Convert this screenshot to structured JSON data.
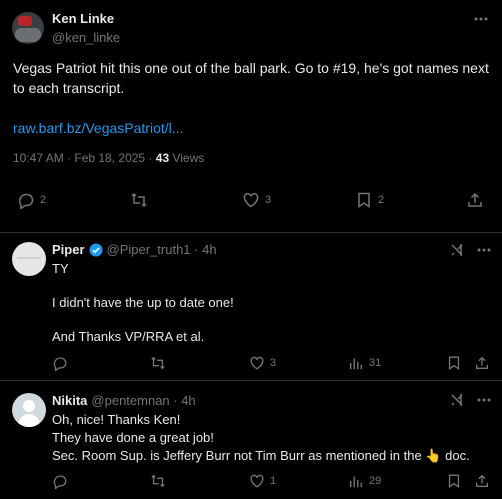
{
  "main_post": {
    "author_name": "Ken Linke",
    "author_handle": "@ken_linke",
    "text": "Vegas Patriot hit this one out of the ball park. Go to #19, he's got names next to each transcript.",
    "link": "raw.barf.bz/VegasPatriot/l...",
    "timestamp": "10:47 AM · Feb 18, 2025 · ",
    "views_count": "43",
    "views_label": " Views",
    "stats": {
      "replies": "2",
      "reposts": "",
      "likes": "3",
      "bookmarks": "2"
    }
  },
  "replies": [
    {
      "author_name": "Piper",
      "author_handle": "@Piper_truth1 · 4h",
      "lines": [
        "TY",
        "I didn't have the up to date one!",
        "And Thanks VP/RRA et al."
      ],
      "stats": {
        "replies": "",
        "reposts": "",
        "likes": "3",
        "views": "31"
      }
    },
    {
      "author_name": "Nikita",
      "author_handle": "@pentemnan · 4h",
      "lines": [
        "Oh, nice! Thanks Ken!",
        "They have done a great job!",
        "Sec. Room Sup. is Jeffery Burr not Tim Burr as mentioned in the ",
        " doc."
      ],
      "emoji": "👆",
      "stats": {
        "replies": "",
        "reposts": "",
        "likes": "1",
        "views": "29"
      }
    }
  ],
  "colors": {
    "background": "#000000",
    "text": "#e7e9ea",
    "muted": "#71767b",
    "link": "#1d9bf0",
    "verified": "#1d9bf0",
    "divider": "#2f3336"
  }
}
